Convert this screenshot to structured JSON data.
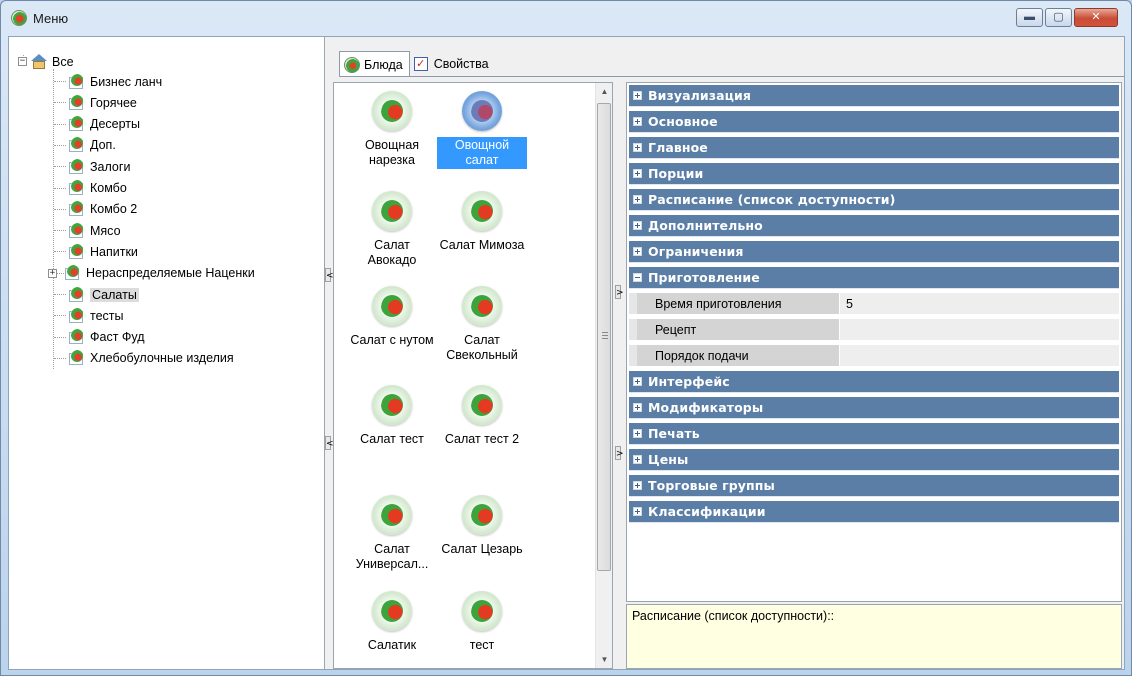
{
  "window": {
    "title": "Меню",
    "buttons": {
      "minimize": "▬",
      "maximize": "▢",
      "close": "✕"
    }
  },
  "tree": {
    "root": {
      "label": "Все",
      "expanded": true
    },
    "items": [
      {
        "label": "Бизнес ланч"
      },
      {
        "label": "Горячее"
      },
      {
        "label": "Десерты"
      },
      {
        "label": "Доп."
      },
      {
        "label": "Залоги"
      },
      {
        "label": "Комбо"
      },
      {
        "label": "Комбо 2"
      },
      {
        "label": "Мясо"
      },
      {
        "label": "Напитки"
      },
      {
        "label": "Нераспределяемые Наценки",
        "expandable": true
      },
      {
        "label": "Салаты",
        "selected": true
      },
      {
        "label": "тесты"
      },
      {
        "label": "Фаст Фуд"
      },
      {
        "label": "Хлебобулочные изделия"
      }
    ]
  },
  "tabs": [
    {
      "label": "Блюда",
      "icon": "dish-icon",
      "active": true
    },
    {
      "label": "Свойства",
      "icon": "checkbox-icon",
      "active": false
    }
  ],
  "dishes": [
    {
      "label": "Овощная нарезка"
    },
    {
      "label": "Овощной салат",
      "selected": true
    },
    {
      "label": "Салат Авокадо"
    },
    {
      "label": "Салат Мимоза"
    },
    {
      "label": "Салат с нутом"
    },
    {
      "label": "Салат Свекольный"
    },
    {
      "label": "Салат тест"
    },
    {
      "label": "Салат тест 2"
    },
    {
      "label": "Салат Универсал..."
    },
    {
      "label": "Салат Цезарь"
    },
    {
      "label": "Салатик"
    },
    {
      "label": "тест"
    }
  ],
  "properties": {
    "categories_before": [
      {
        "label": "Визуализация"
      },
      {
        "label": "Основное"
      },
      {
        "label": "Главное"
      },
      {
        "label": "Порции"
      },
      {
        "label": "Расписание (список доступности)"
      },
      {
        "label": "Дополнительно"
      },
      {
        "label": "Ограничения"
      }
    ],
    "expanded_category": {
      "label": "Приготовление",
      "rows": [
        {
          "name": "Время приготовления",
          "value": "5"
        },
        {
          "name": "Рецепт",
          "value": ""
        },
        {
          "name": "Порядок подачи",
          "value": ""
        }
      ]
    },
    "categories_after": [
      {
        "label": "Интерфейс"
      },
      {
        "label": "Модификаторы"
      },
      {
        "label": "Печать"
      },
      {
        "label": "Цены"
      },
      {
        "label": "Торговые группы"
      },
      {
        "label": "Классификации"
      }
    ]
  },
  "description": {
    "text": "Расписание (список доступности)::"
  },
  "splitters": {
    "arrow_left": "<",
    "arrow_right": ">",
    "grip": "≡"
  },
  "colors": {
    "category_header": "#5b7ea6",
    "selection": "#3399ff",
    "description_bg": "#ffffe1"
  }
}
